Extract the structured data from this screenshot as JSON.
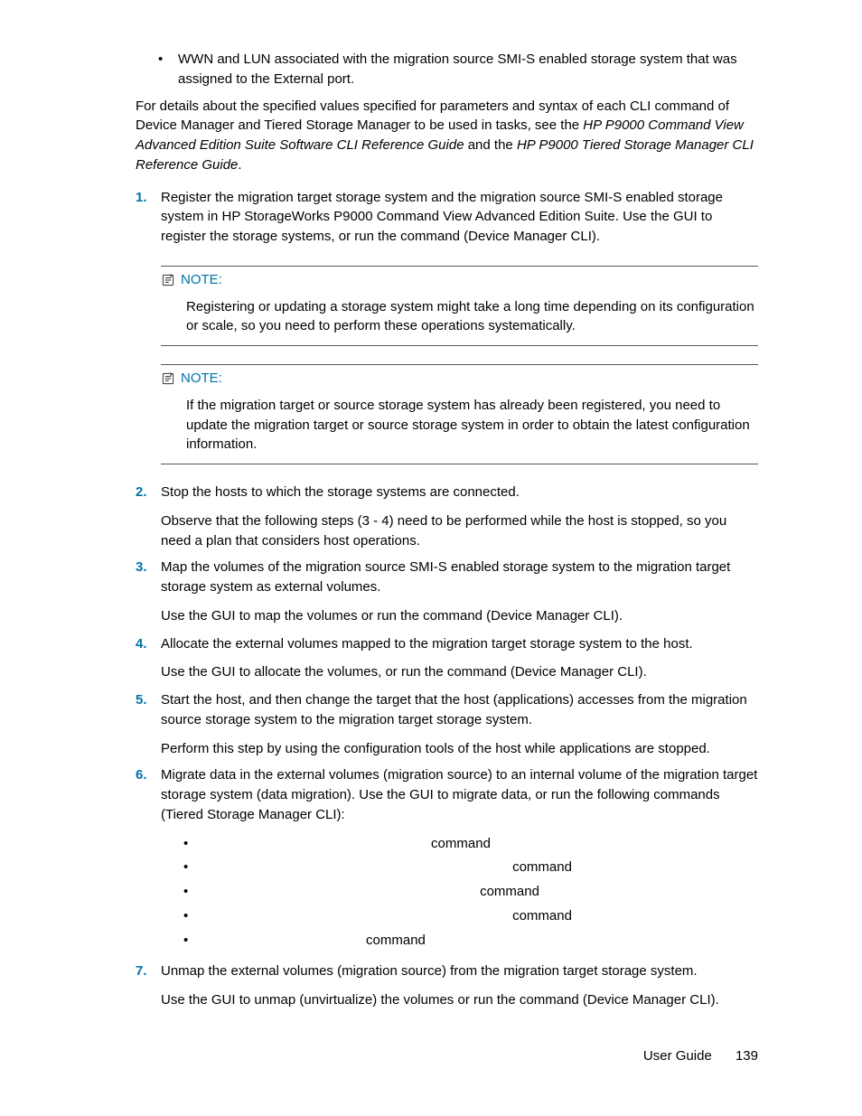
{
  "intro_bullet": "WWN and LUN associated with the migration source SMI-S enabled storage system that was assigned to the External port.",
  "para_lead": "For details about the specified values specified for parameters and syntax of each CLI command of Device Manager and Tiered Storage Manager to be used in tasks, see the ",
  "ref1": "HP P9000 Command View Advanced Edition Suite Software CLI Reference Guide",
  "para_mid": " and the ",
  "ref2": "HP P9000 Tiered Storage Manager CLI Reference Guide",
  "para_end": ".",
  "steps": {
    "s1": "Register the migration target storage system and the migration source SMI-S enabled storage system in HP StorageWorks P9000 Command View Advanced Edition Suite. Use the GUI to register the storage systems, or run the ",
    "s1b": " command (Device Manager CLI).",
    "note_label": "NOTE:",
    "note1_body": "Registering or updating a storage system might take a long time depending on its configuration or scale, so you need to perform these operations systematically.",
    "note2_body": "If the migration target or source storage system has already been registered, you need to update the migration target or source storage system in order to obtain the latest configuration information.",
    "s2a": "Stop the hosts to which the storage systems are connected.",
    "s2b": "Observe that the following steps (3 - 4) need to be performed while the host is stopped, so you need a plan that considers host operations.",
    "s3a": "Map the volumes of the migration source SMI-S enabled storage system to the migration target storage system as external volumes.",
    "s3b_pre": "Use the GUI to map the volumes or run the ",
    "s3b_post": " command (Device Manager CLI).",
    "s4a": "Allocate the external volumes mapped to the migration target storage system to the host.",
    "s4b_pre": "Use the GUI to allocate the volumes, or run the ",
    "s4b_post": " command (Device Manager CLI).",
    "s5a": "Start the host, and then change the target that the host (applications) accesses from the migration source storage system to the migration target storage system.",
    "s5b": "Perform this step by using the configuration tools of the host while applications are stopped.",
    "s6a": "Migrate data in the external volumes (migration source) to an internal volume of the migration target storage system (data migration). Use the GUI to migrate data, or run the following commands (Tiered Storage Manager CLI):",
    "s6_cmds": {
      "pad1": "                            ",
      "pad2": "                                      ",
      "pad3": "                                  ",
      "pad4": "                                      ",
      "pad5": "                    ",
      "suffix": " command"
    },
    "s7a": "Unmap the external volumes (migration source) from the migration target storage system.",
    "s7b_pre": "Use the GUI to unmap (unvirtualize) the volumes or run the ",
    "s7b_post": " command (Device Manager CLI)."
  },
  "nums": {
    "n1": "1.",
    "n2": "2.",
    "n3": "3.",
    "n4": "4.",
    "n5": "5.",
    "n6": "6.",
    "n7": "7."
  },
  "footer_label": "User Guide",
  "footer_page": "139",
  "bullet": "•"
}
